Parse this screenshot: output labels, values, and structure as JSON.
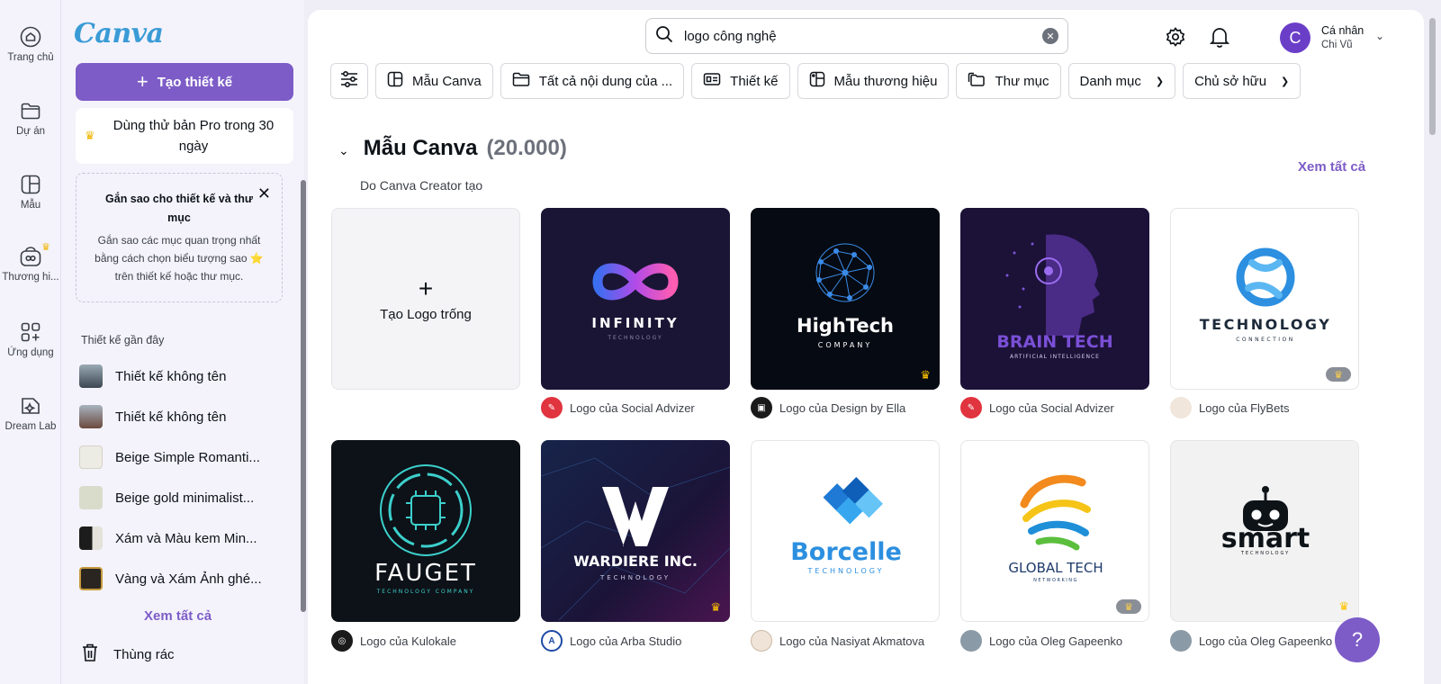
{
  "rail": {
    "home": "Trang chủ",
    "projects": "Dự án",
    "templates": "Mẫu",
    "brand": "Thương hi...",
    "apps": "Ứng dụng",
    "dreamlab": "Dream Lab"
  },
  "sidebar": {
    "logo": "Canva",
    "create_label": "Tạo thiết kế",
    "promo": "Dùng thử bản Pro trong 30 ngày",
    "tip_title": "Gắn sao cho thiết kế và thư mục",
    "tip_body": "Gắn sao các mục quan trọng nhất bằng cách chọn biểu tượng sao ⭐ trên thiết kế hoặc thư mục.",
    "recent_label": "Thiết kế gần đây",
    "recent": [
      {
        "name": "Thiết kế không tên"
      },
      {
        "name": "Thiết kế không tên"
      },
      {
        "name": "Beige Simple Romanti..."
      },
      {
        "name": "Beige gold minimalist..."
      },
      {
        "name": "Xám và Màu kem Min..."
      },
      {
        "name": "Vàng và Xám Ảnh ghé..."
      }
    ],
    "see_all": "Xem tất cả",
    "trash": "Thùng rác"
  },
  "header": {
    "search_value": "logo công nghệ",
    "account_name": "Cá nhân",
    "account_user": "Chi Vũ",
    "avatar_letter": "C"
  },
  "filters": [
    "Mẫu Canva",
    "Tất cả nội dung của ...",
    "Thiết kế",
    "Mẫu thương hiệu",
    "Thư mục",
    "Danh mục",
    "Chủ sở hữu"
  ],
  "section": {
    "title": "Mẫu Canva",
    "count": "(20.000)",
    "subtitle": "Do Canva Creator tạo",
    "see_all": "Xem tất cả"
  },
  "blank_card": {
    "label": "Tạo Logo trống"
  },
  "cards": [
    {
      "title": "INFINITY",
      "tagline": "TECHNOLOGY",
      "author": "Logo của Social Advizer"
    },
    {
      "title": "HighTech",
      "tagline": "COMPANY",
      "author": "Logo của Design by Ella"
    },
    {
      "title": "BRAIN TECH",
      "tagline": "ARTIFICIAL INTELLIGENCE",
      "author": "Logo của Social Advizer"
    },
    {
      "title": "TECHNOLOGY",
      "tagline": "CONNECTION",
      "author": "Logo của FlyBets"
    },
    {
      "title": "FAUGET",
      "tagline": "TECHNOLOGY COMPANY",
      "author": "Logo của Kulokale"
    },
    {
      "title": "WARDIERE INC.",
      "tagline": "TECHNOLOGY",
      "author": "Logo của Arba Studio"
    },
    {
      "title": "Borcelle",
      "tagline": "TECHNOLOGY",
      "author": "Logo của Nasiyat Akmatova"
    },
    {
      "title": "GLOBAL TECH",
      "tagline": "NETWORKING",
      "author": "Logo của Oleg Gapeenko"
    },
    {
      "title": "smart",
      "tagline": "TECHNOLOGY",
      "author": "Logo của Oleg Gapeenko"
    }
  ],
  "help": "?",
  "colors": {
    "accent": "#7d5cc7",
    "brand": "#3a9bd6",
    "crown": "#ffc400"
  }
}
